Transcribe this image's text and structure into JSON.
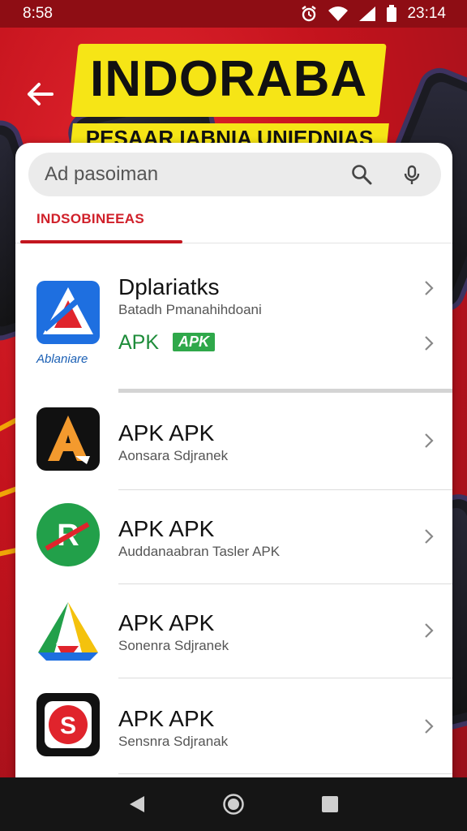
{
  "status_bar": {
    "time_left": "8:58",
    "time_right": "23:14"
  },
  "hero": {
    "title": "INDORABA",
    "subtitle": "PESAAR IABNIA UNIEDNIAS"
  },
  "search": {
    "placeholder": "Ad pasoiman"
  },
  "tabs": [
    {
      "label": "INDSOBINEEAS"
    }
  ],
  "featured_app": {
    "name": "Dplariatks",
    "description": "Batadh Pmanahihdoani",
    "logo_label": "Ablaniare",
    "apk_text": "APK",
    "apk_badge": "APK"
  },
  "apps": [
    {
      "name": "APK APK",
      "description": "Aonsara Sdjranek",
      "icon": "orange-a-icon"
    },
    {
      "name": "APK APK",
      "description": "Auddanaabran Tasler APK",
      "icon": "green-r-icon"
    },
    {
      "name": "APK APK",
      "description": "Sonenra Sdjranek",
      "icon": "drive-a-icon"
    },
    {
      "name": "APK APK",
      "description": "Sensnra Sdjranak",
      "icon": "red-s-icon"
    }
  ],
  "colors": {
    "accent": "#c3161f",
    "hero_yellow": "#f6e516",
    "apk_green": "#2fa84a"
  }
}
